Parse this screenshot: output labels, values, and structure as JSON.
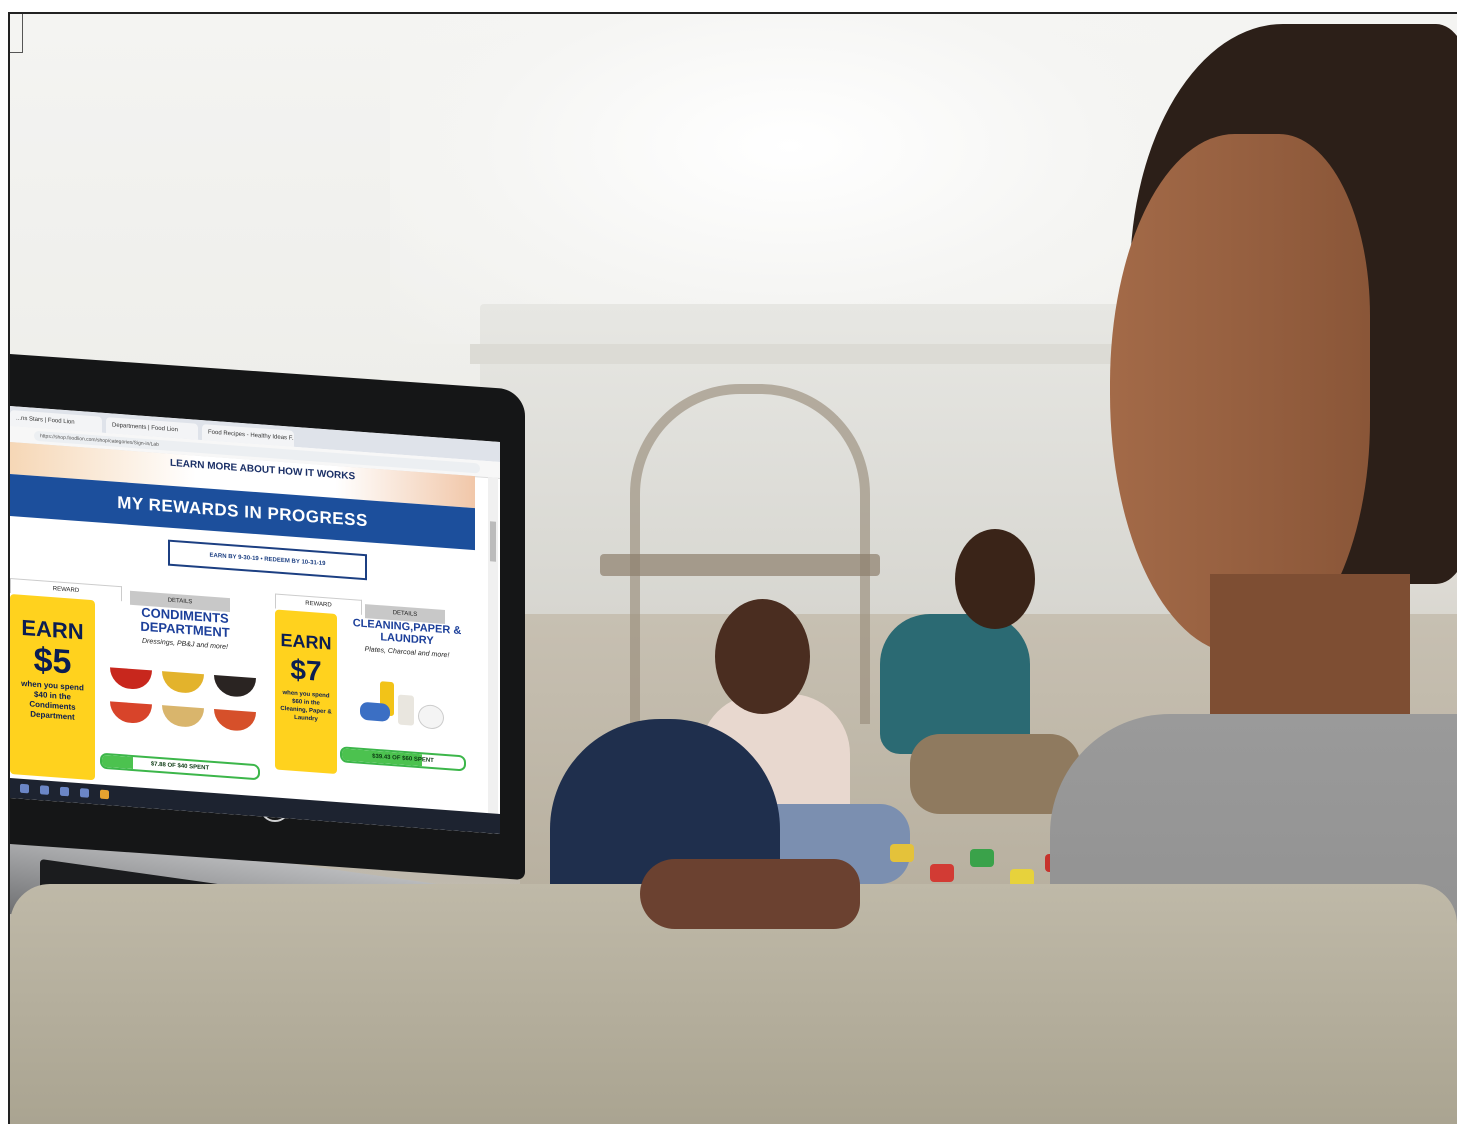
{
  "screen": {
    "tabs": [
      "...ns Stars | Food Lion",
      "Departments | Food Lion",
      "Food Recipes - Healthy Ideas F..."
    ],
    "url": "https://shop.foodlion.com/shop/categories/Sign-in/Lab",
    "learn_more": "LEARN MORE ABOUT HOW IT WORKS",
    "banner_title": "MY REWARDS IN PROGRESS",
    "dates": "EARN BY 9-30-19 • REDEEM BY 10-31-19",
    "cards": [
      {
        "reward_tab": "REWARD",
        "details_tab": "DETAILS",
        "earn": "EARN",
        "amount": "$5",
        "condition": "when you spend $40 in the Condiments Department",
        "department": "CONDIMENTS DEPARTMENT",
        "examples": "Dressings, PB&J and more!",
        "progress_fraction": 0.197,
        "progress_label": "$7.88 OF $40 SPENT"
      },
      {
        "reward_tab": "REWARD",
        "details_tab": "DETAILS",
        "earn": "EARN",
        "amount": "$7",
        "condition": "when you spend $60 in the Cleaning, Paper & Laundry",
        "department": "CLEANING,PAPER & LAUNDRY",
        "examples": "Plates, Charcoal and more!",
        "progress_fraction": 0.657,
        "progress_label": "$39.43 OF $60 SPENT"
      }
    ]
  },
  "laptop": {
    "brand_logo": "hp"
  },
  "colors": {
    "banner": "#1c4f9c",
    "reward_card": "#ffd21e",
    "progress": "#4cc24f"
  }
}
